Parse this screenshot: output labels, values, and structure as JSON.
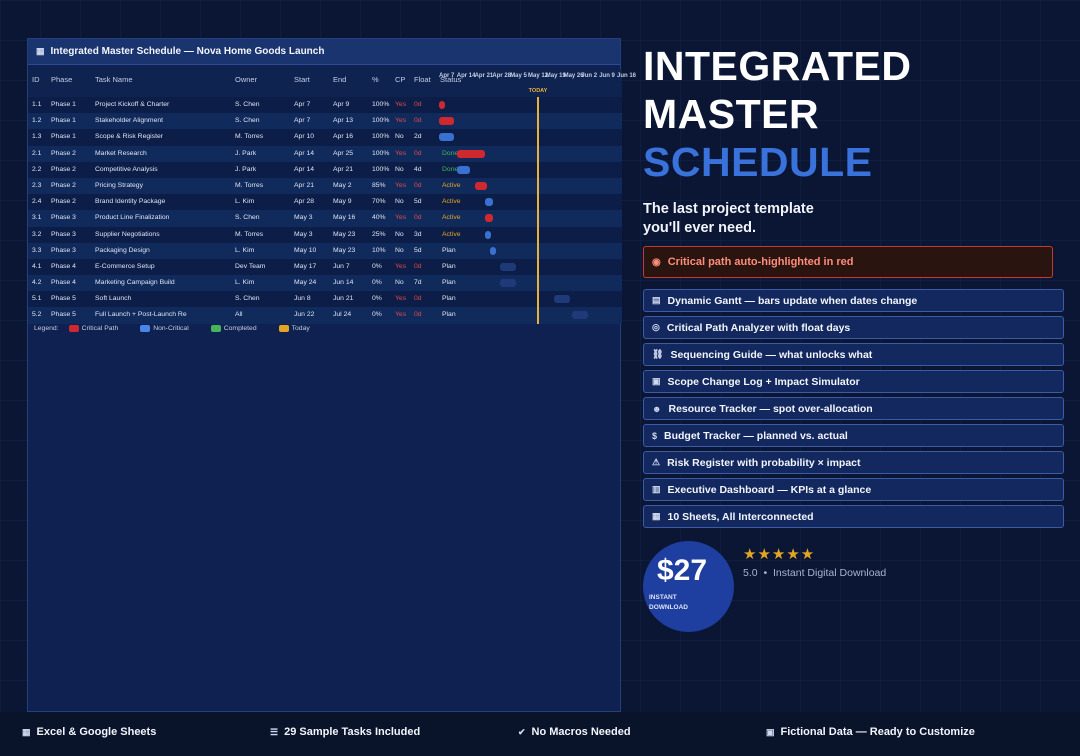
{
  "panel": {
    "title": "Integrated Master Schedule — Nova Home Goods Launch",
    "columns": {
      "id": "ID",
      "phase": "Phase",
      "task": "Task Name",
      "owner": "Owner",
      "start": "Start",
      "end": "End",
      "pct": "%",
      "cp": "CP",
      "float": "Float",
      "status": "Status"
    },
    "dates": [
      "Apr 7",
      "Apr 14",
      "Apr 21",
      "Apr 28",
      "May 5",
      "May 12",
      "May 19",
      "May 26",
      "Jun 2",
      "Jun 9",
      "Jun 16"
    ],
    "today_label": "TODAY",
    "rows": [
      {
        "id": "1.1",
        "phase": "Phase 1",
        "task": "Project Kickoff & Charter",
        "owner": "S. Chen",
        "start": "Apr 7",
        "end": "Apr 9",
        "pct": "100%",
        "cp": "Yes",
        "float": "0d",
        "status": "",
        "bar": "crit",
        "bar_start": 0,
        "bar_dur": 2
      },
      {
        "id": "1.2",
        "phase": "Phase 1",
        "task": "Stakeholder Alignment",
        "owner": "S. Chen",
        "start": "Apr 7",
        "end": "Apr 13",
        "pct": "100%",
        "cp": "Yes",
        "float": "0d",
        "status": "",
        "bar": "crit",
        "bar_start": 0,
        "bar_dur": 6
      },
      {
        "id": "1.3",
        "phase": "Phase 1",
        "task": "Scope & Risk Register",
        "owner": "M. Torres",
        "start": "Apr 10",
        "end": "Apr 16",
        "pct": "100%",
        "cp": "No",
        "float": "2d",
        "status": "",
        "bar": "noncrit",
        "bar_start": 0,
        "bar_dur": 6
      },
      {
        "id": "2.1",
        "phase": "Phase 2",
        "task": "Market Research",
        "owner": "J. Park",
        "start": "Apr 14",
        "end": "Apr 25",
        "pct": "100%",
        "cp": "Yes",
        "float": "0d",
        "status": "Done",
        "bar": "crit",
        "bar_start": 7,
        "bar_dur": 11
      },
      {
        "id": "2.2",
        "phase": "Phase 2",
        "task": "Competitive Analysis",
        "owner": "J. Park",
        "start": "Apr 14",
        "end": "Apr 21",
        "pct": "100%",
        "cp": "No",
        "float": "4d",
        "status": "Done",
        "bar": "noncrit",
        "bar_start": 7,
        "bar_dur": 5
      },
      {
        "id": "2.3",
        "phase": "Phase 2",
        "task": "Pricing Strategy",
        "owner": "M. Torres",
        "start": "Apr 21",
        "end": "May 2",
        "pct": "85%",
        "cp": "Yes",
        "float": "0d",
        "status": "Active",
        "bar": "crit",
        "bar_start": 14,
        "bar_dur": 5
      },
      {
        "id": "2.4",
        "phase": "Phase 2",
        "task": "Brand Identity Package",
        "owner": "L. Kim",
        "start": "Apr 28",
        "end": "May 9",
        "pct": "70%",
        "cp": "No",
        "float": "5d",
        "status": "Active",
        "bar": "noncrit",
        "bar_start": 18,
        "bar_dur": 3
      },
      {
        "id": "3.1",
        "phase": "Phase 3",
        "task": "Product Line Finalization",
        "owner": "S. Chen",
        "start": "May 3",
        "end": "May 16",
        "pct": "40%",
        "cp": "Yes",
        "float": "0d",
        "status": "Active",
        "bar": "crit",
        "bar_start": 18,
        "bar_dur": 3
      },
      {
        "id": "3.2",
        "phase": "Phase 3",
        "task": "Supplier Negotiations",
        "owner": "M. Torres",
        "start": "May 3",
        "end": "May 23",
        "pct": "25%",
        "cp": "No",
        "float": "3d",
        "status": "Active",
        "bar": "noncrit",
        "bar_start": 18,
        "bar_dur": 2
      },
      {
        "id": "3.3",
        "phase": "Phase 3",
        "task": "Packaging Design",
        "owner": "L. Kim",
        "start": "May 10",
        "end": "May 23",
        "pct": "10%",
        "cp": "No",
        "float": "5d",
        "status": "Plan",
        "bar": "noncrit",
        "bar_start": 20,
        "bar_dur": 1
      },
      {
        "id": "4.1",
        "phase": "Phase 4",
        "task": "E-Commerce Setup",
        "owner": "Dev Team",
        "start": "May 17",
        "end": "Jun 7",
        "pct": "0%",
        "cp": "Yes",
        "float": "0d",
        "status": "Plan",
        "bar": "plan",
        "bar_start": 24,
        "bar_dur": 0
      },
      {
        "id": "4.2",
        "phase": "Phase 4",
        "task": "Marketing Campaign Build",
        "owner": "L. Kim",
        "start": "May 24",
        "end": "Jun 14",
        "pct": "0%",
        "cp": "No",
        "float": "7d",
        "status": "Plan",
        "bar": "plan",
        "bar_start": 24,
        "bar_dur": 0
      },
      {
        "id": "5.1",
        "phase": "Phase 5",
        "task": "Soft Launch",
        "owner": "S. Chen",
        "start": "Jun 8",
        "end": "Jun 21",
        "pct": "0%",
        "cp": "Yes",
        "float": "0d",
        "status": "Plan",
        "bar": "plan",
        "bar_start": 45,
        "bar_dur": 0
      },
      {
        "id": "5.2",
        "phase": "Phase 5",
        "task": "Full Launch + Post-Launch Re",
        "owner": "All",
        "start": "Jun 22",
        "end": "Jul 24",
        "pct": "0%",
        "cp": "Yes",
        "float": "0d",
        "status": "Plan",
        "bar": "plan",
        "bar_start": 52,
        "bar_dur": 0
      }
    ],
    "legend": {
      "title": "Legend:",
      "items": [
        {
          "label": "Critical Path",
          "color": "#d0282f"
        },
        {
          "label": "Non-Critical",
          "color": "#4a86e8"
        },
        {
          "label": "Completed",
          "color": "#45b45a"
        },
        {
          "label": "Today",
          "color": "#e3a623"
        }
      ]
    }
  },
  "hero": {
    "line1": "INTEGRATED",
    "line2": "MASTER",
    "line3": "SCHEDULE",
    "tagline1": "The last project template",
    "tagline2": "you'll ever need.",
    "critical": "Critical path auto-highlighted in red"
  },
  "features": [
    "Dynamic Gantt — bars update when dates change",
    "Critical Path Analyzer with float days",
    "Sequencing Guide — what unlocks what",
    "Scope Change Log + Impact Simulator",
    "Resource Tracker — spot over-allocation",
    "Budget Tracker — planned vs. actual",
    "Risk Register with probability × impact",
    "Executive Dashboard — KPIs at a glance",
    "10 Sheets, All Interconnected"
  ],
  "price": {
    "amount": "$27",
    "sub1": "INSTANT",
    "sub2": "DOWNLOAD",
    "stars": "★★★★★",
    "rating": "5.0",
    "rating_sep": "•",
    "rating_text": "Instant Digital Download"
  },
  "footer": [
    "Excel & Google Sheets",
    "29 Sample Tasks Included",
    "No Macros Needed",
    "Fictional Data — Ready to Customize"
  ],
  "colors": {
    "critical": "#d0282f",
    "non_critical": "#3a70d0",
    "completed": "#45b45a",
    "today": "#e3a623",
    "accent_blue": "#3a72dc"
  }
}
